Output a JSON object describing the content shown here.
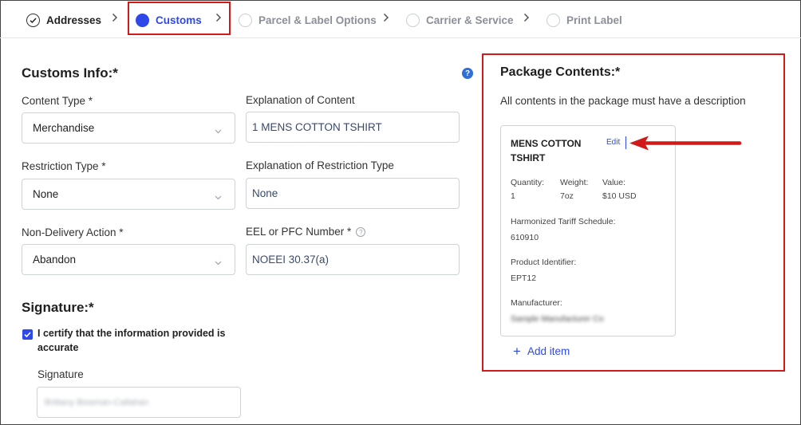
{
  "stepper": {
    "steps": [
      {
        "label": "Addresses",
        "state": "done"
      },
      {
        "label": "Customs",
        "state": "current"
      },
      {
        "label": "Parcel & Label Options",
        "state": "pending"
      },
      {
        "label": "Carrier & Service",
        "state": "pending"
      },
      {
        "label": "Print Label",
        "state": "pending"
      }
    ]
  },
  "customs": {
    "heading": "Customs Info:*",
    "help_icon": "?",
    "content_type": {
      "label": "Content Type *",
      "value": "Merchandise"
    },
    "explanation_content": {
      "label": "Explanation of Content",
      "value": "1 MENS COTTON TSHIRT"
    },
    "restriction_type": {
      "label": "Restriction Type *",
      "value": "None"
    },
    "explanation_restriction": {
      "label": "Explanation of Restriction Type",
      "value": "None"
    },
    "non_delivery": {
      "label": "Non-Delivery Action *",
      "value": "Abandon"
    },
    "eel_pfc": {
      "label": "EEL or PFC Number *",
      "value": "NOEEI 30.37(a)",
      "help_icon": "?"
    }
  },
  "signature": {
    "heading": "Signature:*",
    "certify_label": "I certify that the information provided is accurate",
    "certify_checked": true,
    "field_label": "Signature",
    "field_value": "Brittany Bowman-Callahan"
  },
  "package": {
    "heading": "Package Contents:*",
    "subtitle": "All contents in the package must have a description",
    "item": {
      "title": "MENS COTTON TSHIRT",
      "edit_label": "Edit",
      "quantity_label": "Quantity:",
      "quantity": "1",
      "weight_label": "Weight:",
      "weight": "7oz",
      "value_label": "Value:",
      "value": "$10 USD",
      "hts_label": "Harmonized Tariff Schedule:",
      "hts": "610910",
      "product_id_label": "Product Identifier:",
      "product_id": "EPT12",
      "manufacturer_label": "Manufacturer:",
      "manufacturer": "Sample Manufacturer Co"
    },
    "add_item_label": "Add item"
  },
  "colors": {
    "accent": "#2f49e8",
    "highlight": "#d11a1a"
  }
}
